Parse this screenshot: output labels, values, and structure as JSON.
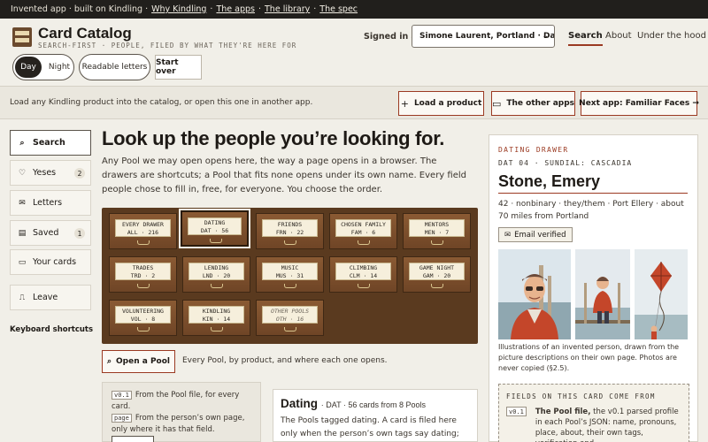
{
  "topstrip": {
    "prefix": "Invented app · built on Kindling ·",
    "links": [
      "Why Kindling",
      "The apps",
      "The library",
      "The spec"
    ]
  },
  "header": {
    "brand": "Card Catalog",
    "tagline": "SEARCH-FIRST · PEOPLE, FILED BY WHAT THEY'RE HERE FOR",
    "signed_in_label": "Signed in as",
    "identity": "Simone Laurent, Portland · Dating",
    "nav": [
      "Search",
      "About",
      "Under the hood"
    ],
    "active_nav": "Search",
    "theme": {
      "day": "Day",
      "night": "Night",
      "selected": "Day"
    },
    "readable_letters": "Readable letters",
    "start_over": "Start over"
  },
  "loadbar": {
    "text": "Load any Kindling product into the catalog, or open this one in another app.",
    "load_product": "Load a product",
    "other_apps": "The other apps",
    "next_app": "Next app: Familiar Faces →"
  },
  "sidebar": {
    "items": [
      {
        "label": "Search",
        "count": "",
        "icon": "search-icon"
      },
      {
        "label": "Yeses",
        "count": "2",
        "icon": "heart-icon"
      },
      {
        "label": "Letters",
        "count": "",
        "icon": "envelope-icon"
      },
      {
        "label": "Saved",
        "count": "1",
        "icon": "bookmark-icon"
      },
      {
        "label": "Your cards",
        "count": "",
        "icon": "card-icon"
      },
      {
        "label": "Leave",
        "count": "",
        "icon": "door-icon"
      }
    ],
    "keyboard": "Keyboard shortcuts"
  },
  "main": {
    "title": "Look up the people you’re looking for.",
    "intro": "Any Pool we may open opens here, the way a page opens in a browser. The drawers are shortcuts; a Pool that fits none opens under its own name. Every field people chose to fill in, free, for everyone. You choose the order.",
    "drawers": [
      {
        "name": "EVERY DRAWER",
        "code": "ALL · 216"
      },
      {
        "name": "DATING",
        "code": "DAT · 56"
      },
      {
        "name": "FRIENDS",
        "code": "FRN · 22"
      },
      {
        "name": "CHOSEN FAMILY",
        "code": "FAM · 6"
      },
      {
        "name": "MENTORS",
        "code": "MEN · 7"
      },
      {
        "name": "TRADES",
        "code": "TRD · 2"
      },
      {
        "name": "LENDING",
        "code": "LND · 20"
      },
      {
        "name": "MUSIC",
        "code": "MUS · 31"
      },
      {
        "name": "CLIMBING",
        "code": "CLM · 14"
      },
      {
        "name": "GAME NIGHT",
        "code": "GAM · 20"
      },
      {
        "name": "VOLUNTEERING",
        "code": "VOL · 8"
      },
      {
        "name": "KINDLING",
        "code": "KIN · 14"
      },
      {
        "name": "OTHER POOLS",
        "code": "OTH · 16"
      }
    ],
    "selected_drawer": "DATING",
    "open_pool": "Open a Pool",
    "open_pool_note": "Every Pool, by product, and where each one opens.",
    "legend": [
      {
        "tag": "v0.1",
        "text": "From the Pool file, for every card."
      },
      {
        "tag": "page",
        "text": "From the person’s own page, only where it has that field."
      }
    ],
    "pool": {
      "name": "Dating",
      "meta": "· DAT · 56 cards from 8 Pools",
      "desc": "The Pools tagged dating. A card is filed here only when the person’s own tags say dating; no one is"
    }
  },
  "card": {
    "drawer": "DATING DRAWER",
    "code": "DAT 04 · SUNDIAL: CASCADIA",
    "name": "Stone, Emery",
    "details": "42 · nonbinary · they/them · Port Ellery · about 70 miles from Portland",
    "verified": "Email verified",
    "caption": "Illustrations of an invented person, drawn from the picture descriptions on their own page. Photos are never copied (§2.5).",
    "fields_title": "FIELDS ON THIS CARD COME FROM",
    "fields_tag": "v0.1",
    "fields_lead": "The Pool file,",
    "fields_text": "the v0.1 parsed profile in each Pool’s JSON: name, pronouns, place, about, their own tags, verification and"
  },
  "colors": {
    "accent": "#9b3a22",
    "cabinet": "#5a3a1f",
    "ink": "#1e1a16",
    "paper": "#f1efe8"
  }
}
